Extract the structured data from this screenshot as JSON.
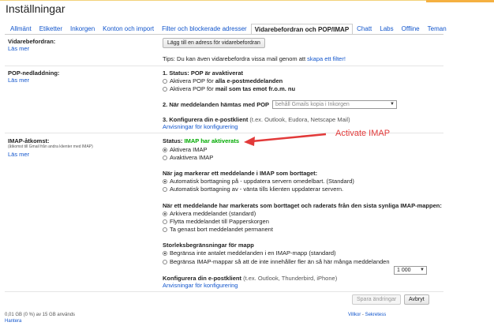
{
  "page_title": "Inställningar",
  "tabs": [
    {
      "label": "Allmänt"
    },
    {
      "label": "Etiketter"
    },
    {
      "label": "Inkorgen"
    },
    {
      "label": "Konton och import"
    },
    {
      "label": "Filter och blockerade adresser"
    },
    {
      "label": "Vidarebefordran och POP/IMAP"
    },
    {
      "label": "Chatt"
    },
    {
      "label": "Labs"
    },
    {
      "label": "Offline"
    },
    {
      "label": "Teman"
    }
  ],
  "forwarding": {
    "label": "Vidarebefordran:",
    "learn_more": "Läs mer",
    "add_button": "Lägg till en adress för vidarebefordran",
    "tip_prefix": "Tips: Du kan även vidarebefordra vissa mail genom att",
    "tip_link": "skapa ett filter!"
  },
  "pop": {
    "label": "POP-nedladdning:",
    "learn_more": "Läs mer",
    "status_prefix": "1. Status: ",
    "status_value": "POP är avaktiverat",
    "opt1_prefix": "Aktivera POP för ",
    "opt1_bold": "alla e-postmeddelanden",
    "opt2_prefix": "Aktivera POP för ",
    "opt2_bold": "mail som tas emot fr.o.m. nu",
    "step2": "2. När meddelanden hämtas med POP",
    "step2_select": "behåll Gmails kopia i Inkorgen",
    "step3_bold": "3. Konfigurera din e-postklient",
    "step3_rest": " (t.ex. Outlook, Eudora, Netscape Mail)",
    "config_link": "Anvisningar för konfigurering"
  },
  "imap": {
    "label": "IMAP-åtkomst:",
    "sublabel": "(åtkomst till Gmail från andra klienter med IMAP)",
    "learn_more": "Läs mer",
    "status_prefix": "Status: ",
    "status_value": "IMAP har aktiverats",
    "enable": "Aktivera IMAP",
    "disable": "Avaktivera IMAP",
    "annotation": "Activate IMAP",
    "delete_heading": "När jag markerar ett meddelande i IMAP som borttaget:",
    "delete_opt1": "Automatisk borttagning på - uppdatera servern omedelbart. (Standard)",
    "delete_opt2": "Automatisk borttagning av - vänta tills klienten uppdaterar servern.",
    "expunge_heading": "När ett meddelande har markerats som borttaget och raderats från den sista synliga IMAP-mappen:",
    "expunge_opt1": "Arkivera meddelandet (standard)",
    "expunge_opt2": "Flytta meddelandet till Papperskorgen",
    "expunge_opt3": "Ta genast bort meddelandet permanent",
    "size_heading": "Storleksbegränsningar för mapp",
    "size_opt1": "Begränsa inte antalet meddelanden i en IMAP-mapp (standard)",
    "size_opt2": "Begränsa IMAP-mappar så att de inte innehåller fler än så här många meddelanden",
    "size_select": "1 000",
    "config_bold": "Konfigurera din e-postklient",
    "config_rest": " (t.ex. Outlook, Thunderbird, iPhone)",
    "config_link": "Anvisningar för konfigurering"
  },
  "actions": {
    "save": "Spara ändringar",
    "cancel": "Avbryt"
  },
  "footer": {
    "storage": "0,01 GB (0 %) av 15 GB används",
    "manage": "Hantera",
    "terms": "Villkor",
    "sep": " - ",
    "privacy": "Sekretess"
  },
  "colors": {
    "link": "#1155cc",
    "status_green": "#00aa00",
    "annotation_red": "#e23a3a"
  }
}
